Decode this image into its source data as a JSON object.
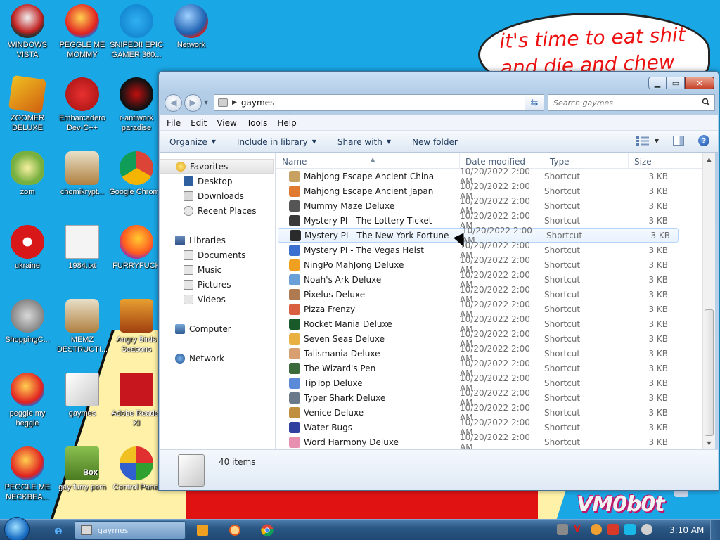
{
  "desktop": {
    "bubble_text": "it's time to eat shit and die and chew",
    "logo_text": "VM0b0t",
    "icons": [
      {
        "label": "WINDOWS VISTA",
        "icon": "vista-ball-icon"
      },
      {
        "label": "PEGGLE ME MOMMY",
        "icon": "peggle-icon"
      },
      {
        "label": "SNIPED!! EPIC GAMER 360...",
        "icon": "skype-icon"
      },
      {
        "label": "Network",
        "icon": "network-globe-icon"
      },
      {
        "label": "ZOOMER DELUXE",
        "icon": "zoomer-icon"
      },
      {
        "label": "Embarcadero Dev-C++",
        "icon": "devcpp-icon"
      },
      {
        "label": "r-antiwork paradise",
        "icon": "antiwork-icon"
      },
      {
        "label": "zom",
        "icon": "flower-icon"
      },
      {
        "label": "chomikrypt...",
        "icon": "chomik-icon"
      },
      {
        "label": "Google Chrome",
        "icon": "chrome-icon"
      },
      {
        "label": "ukraine",
        "icon": "radiation-icon"
      },
      {
        "label": "1984.txt",
        "icon": "text-file-icon"
      },
      {
        "label": "FURRYFUCK",
        "icon": "firefox-icon"
      },
      {
        "label": "ShoppingC...",
        "icon": "flash-icon"
      },
      {
        "label": "MEMZ DESTRUCTI...",
        "icon": "memz-icon"
      },
      {
        "label": "Angry Birds Seasons",
        "icon": "angry-birds-icon"
      },
      {
        "label": "peggle my heggle",
        "icon": "peggle-icon"
      },
      {
        "label": "gaymes",
        "icon": "folder-icon"
      },
      {
        "label": "Adobe Reader XI",
        "icon": "adobe-reader-icon"
      },
      {
        "label": "PEGGLE ME NECKBEA...",
        "icon": "peggle-icon"
      },
      {
        "label": "gay furry porn",
        "icon": "box-game-icon"
      },
      {
        "label": "Control Panel",
        "icon": "control-panel-icon"
      }
    ],
    "box_icon_text": "Box"
  },
  "window": {
    "path": "gaymes",
    "search_placeholder": "Search gaymes",
    "menu": [
      "File",
      "Edit",
      "View",
      "Tools",
      "Help"
    ],
    "toolbar": {
      "organize": "Organize",
      "include": "Include in library",
      "share": "Share with",
      "new_folder": "New folder"
    },
    "nav": {
      "favorites": "Favorites",
      "desktop": "Desktop",
      "downloads": "Downloads",
      "recent": "Recent Places",
      "libraries": "Libraries",
      "documents": "Documents",
      "music": "Music",
      "pictures": "Pictures",
      "videos": "Videos",
      "computer": "Computer",
      "network": "Network"
    },
    "columns": {
      "name": "Name",
      "date": "Date modified",
      "type": "Type",
      "size": "Size"
    },
    "files": [
      {
        "name": "Mahjong Escape Ancient China",
        "date": "10/20/2022 2:00 AM",
        "type": "Shortcut",
        "size": "3 KB",
        "color": "#c8a060"
      },
      {
        "name": "Mahjong Escape Ancient Japan",
        "date": "10/20/2022 2:00 AM",
        "type": "Shortcut",
        "size": "3 KB",
        "color": "#e07a30"
      },
      {
        "name": "Mummy Maze Deluxe",
        "date": "10/20/2022 2:00 AM",
        "type": "Shortcut",
        "size": "3 KB",
        "color": "#555555"
      },
      {
        "name": "Mystery PI - The Lottery Ticket",
        "date": "10/20/2022 2:00 AM",
        "type": "Shortcut",
        "size": "3 KB",
        "color": "#3a3a3a"
      },
      {
        "name": "Mystery PI - The New York Fortune",
        "date": "10/20/2022 2:00 AM",
        "type": "Shortcut",
        "size": "3 KB",
        "color": "#2a2a2a"
      },
      {
        "name": "Mystery PI - The Vegas Heist",
        "date": "10/20/2022 2:00 AM",
        "type": "Shortcut",
        "size": "3 KB",
        "color": "#3b6fd0"
      },
      {
        "name": "NingPo MahJong Deluxe",
        "date": "10/20/2022 2:00 AM",
        "type": "Shortcut",
        "size": "3 KB",
        "color": "#f0a020"
      },
      {
        "name": "Noah's Ark Deluxe",
        "date": "10/20/2022 2:00 AM",
        "type": "Shortcut",
        "size": "3 KB",
        "color": "#6aa0d8"
      },
      {
        "name": "Pixelus Deluxe",
        "date": "10/20/2022 2:00 AM",
        "type": "Shortcut",
        "size": "3 KB",
        "color": "#b07a50"
      },
      {
        "name": "Pizza Frenzy",
        "date": "10/20/2022 2:00 AM",
        "type": "Shortcut",
        "size": "3 KB",
        "color": "#d86040"
      },
      {
        "name": "Rocket Mania Deluxe",
        "date": "10/20/2022 2:00 AM",
        "type": "Shortcut",
        "size": "3 KB",
        "color": "#1a5a2a"
      },
      {
        "name": "Seven Seas Deluxe",
        "date": "10/20/2022 2:00 AM",
        "type": "Shortcut",
        "size": "3 KB",
        "color": "#e8b040"
      },
      {
        "name": "Talismania Deluxe",
        "date": "10/20/2022 2:00 AM",
        "type": "Shortcut",
        "size": "3 KB",
        "color": "#d8a070"
      },
      {
        "name": "The Wizard's Pen",
        "date": "10/20/2022 2:00 AM",
        "type": "Shortcut",
        "size": "3 KB",
        "color": "#3a6a3a"
      },
      {
        "name": "TipTop Deluxe",
        "date": "10/20/2022 2:00 AM",
        "type": "Shortcut",
        "size": "3 KB",
        "color": "#5a8ad8"
      },
      {
        "name": "Typer Shark Deluxe",
        "date": "10/20/2022 2:00 AM",
        "type": "Shortcut",
        "size": "3 KB",
        "color": "#6a7a8a"
      },
      {
        "name": "Venice Deluxe",
        "date": "10/20/2022 2:00 AM",
        "type": "Shortcut",
        "size": "3 KB",
        "color": "#c09040"
      },
      {
        "name": "Water Bugs",
        "date": "10/20/2022 2:00 AM",
        "type": "Shortcut",
        "size": "3 KB",
        "color": "#3040a0"
      },
      {
        "name": "Word Harmony Deluxe",
        "date": "10/20/2022 2:00 AM",
        "type": "Shortcut",
        "size": "3 KB",
        "color": "#e890b0"
      }
    ],
    "hovered_file": "Mystery PI - The New York Fortune",
    "item_count": "40 items"
  },
  "taskbar": {
    "active_window": "gaymes",
    "clock": "3:10 AM"
  }
}
